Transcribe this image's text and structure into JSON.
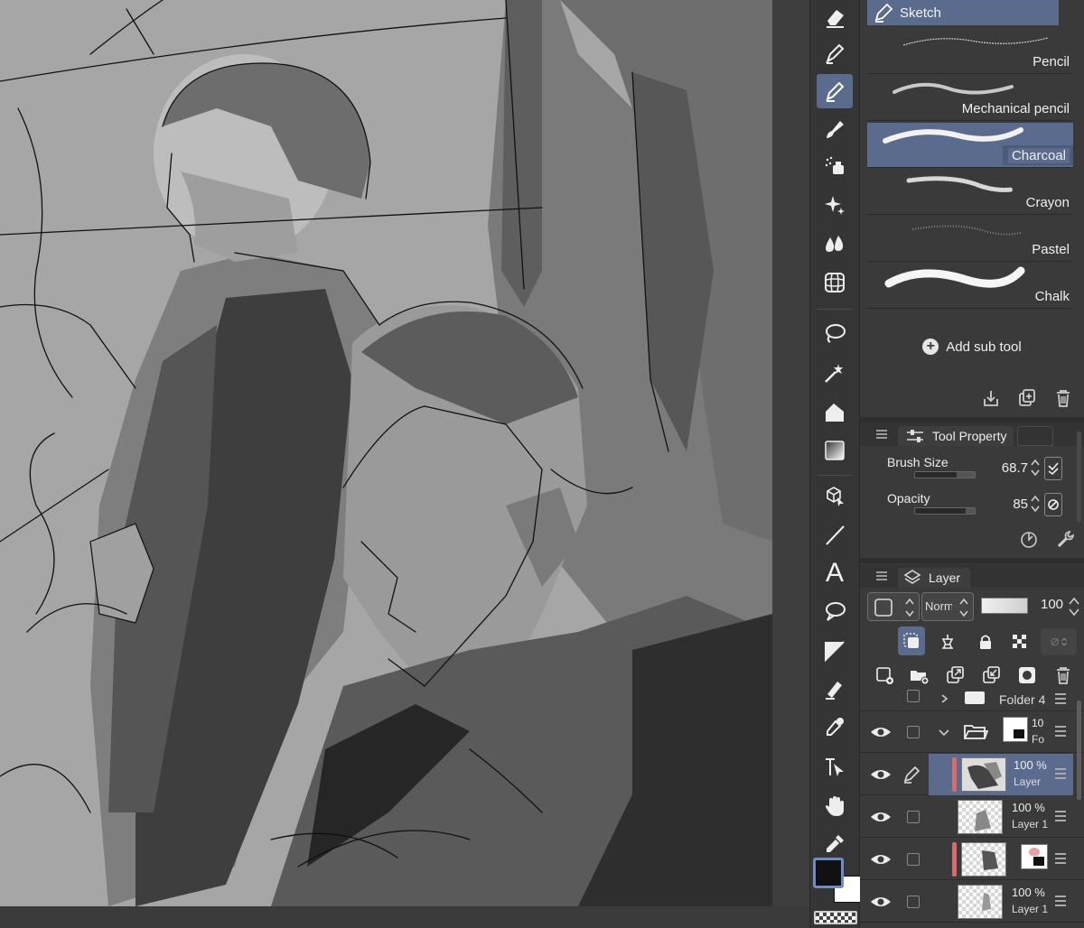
{
  "subtool": {
    "group_name": "Sketch",
    "brushes": [
      {
        "name": "Pencil",
        "selected": false
      },
      {
        "name": "Mechanical pencil",
        "selected": false
      },
      {
        "name": "Charcoal",
        "selected": true
      },
      {
        "name": "Crayon",
        "selected": false
      },
      {
        "name": "Pastel",
        "selected": false
      },
      {
        "name": "Chalk",
        "selected": false
      }
    ],
    "add_label": "Add sub tool"
  },
  "tool_property": {
    "tab_label": "Tool Property",
    "brush_size": {
      "label": "Brush Size",
      "value": "68.7",
      "level": 0.69
    },
    "opacity": {
      "label": "Opacity",
      "value": "85",
      "level": 0.85
    }
  },
  "layer_panel": {
    "tab_label": "Layer",
    "blend_mode": "Norm",
    "opacity_value": "100",
    "layers": [
      {
        "kind": "folder",
        "name": "Folder 4",
        "pct": "",
        "expanded": false
      },
      {
        "kind": "folder",
        "name": "Fo",
        "pct": "10",
        "expanded": true
      },
      {
        "kind": "layer",
        "name": "Layer",
        "pct": "100 %",
        "selected": true
      },
      {
        "kind": "layer",
        "name": "Layer 1",
        "pct": "100 %",
        "selected": false
      },
      {
        "kind": "layer",
        "name": "",
        "pct": "",
        "selected": false
      },
      {
        "kind": "layer",
        "name": "Layer 1",
        "pct": "100 %",
        "selected": false
      }
    ]
  },
  "colors": {
    "accent": "#5b6b8d",
    "main_color": "#111111",
    "sub_color": "#ffffff",
    "layer_color_tag": "#d96b6b"
  },
  "toolbar": {
    "tools": [
      "eraser-icon",
      "pen-icon",
      "pencil-icon",
      "brush-icon",
      "airbrush-icon",
      "decoration-icon",
      "blend-icon",
      "mesh-transform-icon",
      "lasso-icon",
      "auto-select-icon",
      "fill-icon",
      "gradient-icon",
      "3d-object-icon",
      "line-icon",
      "text-icon",
      "balloon-icon",
      "frame-border-icon",
      "correct-line-icon",
      "eyedropper-icon",
      "operation-icon",
      "hand-icon",
      "color-picker-icon"
    ],
    "active_tool": "pencil-icon",
    "text_tool_glyph": "A"
  }
}
